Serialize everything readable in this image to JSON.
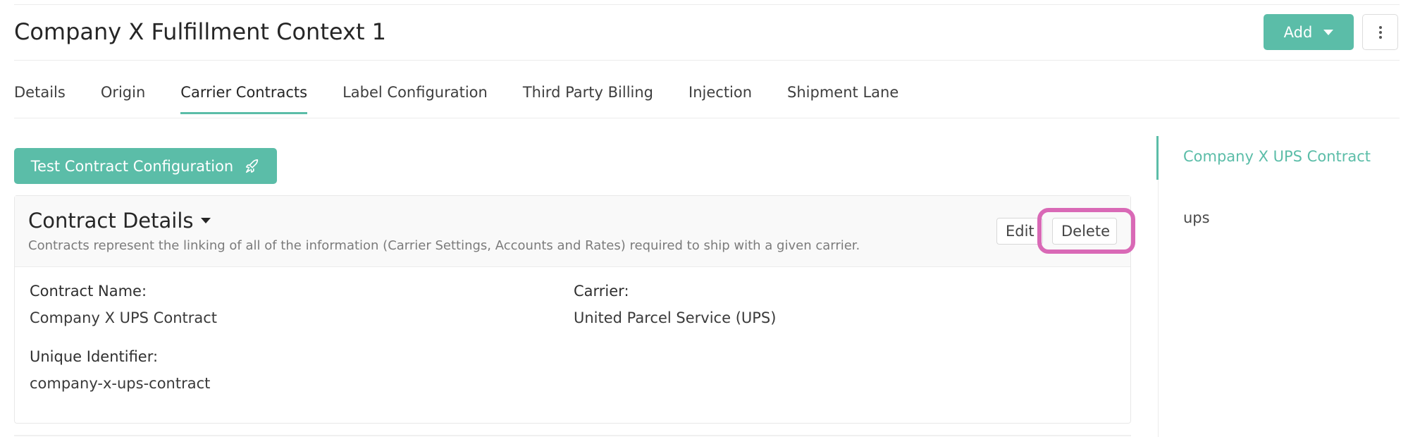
{
  "header": {
    "title": "Company X Fulfillment Context 1",
    "add_label": "Add",
    "more_icon": "vertical-ellipsis-icon"
  },
  "tabs": [
    {
      "label": "Details"
    },
    {
      "label": "Origin"
    },
    {
      "label": "Carrier Contracts",
      "active": true
    },
    {
      "label": "Label Configuration"
    },
    {
      "label": "Third Party Billing"
    },
    {
      "label": "Injection"
    },
    {
      "label": "Shipment Lane"
    }
  ],
  "actions": {
    "test_label": "Test Contract Configuration",
    "test_icon": "rocket-icon"
  },
  "card": {
    "title": "Contract Details",
    "description": "Contracts represent the linking of all of the information (Carrier Settings, Accounts and Rates) required to ship with a given carrier.",
    "edit_label": "Edit",
    "delete_label": "Delete",
    "fields": {
      "contract_name_label": "Contract Name:",
      "contract_name_value": "Company X UPS Contract",
      "carrier_label": "Carrier:",
      "carrier_value": "United Parcel Service (UPS)",
      "identifier_label": "Unique Identifier:",
      "identifier_value": "company-x-ups-contract"
    }
  },
  "sidebar": {
    "items": [
      {
        "label": "Company X UPS Contract",
        "active": true
      },
      {
        "label": "ups"
      }
    ]
  },
  "colors": {
    "accent": "#5bbda8",
    "highlight": "#d969b6"
  }
}
